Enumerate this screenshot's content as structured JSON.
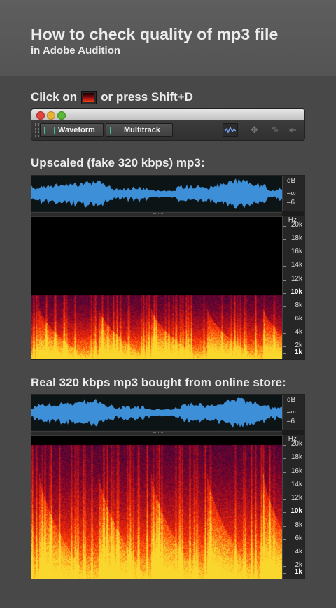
{
  "header": {
    "title": "How to check quality of mp3 file",
    "subtitle": "in Adobe Audition"
  },
  "instruction": {
    "prefix": "Click on",
    "suffix": "or press Shift+D"
  },
  "toolbar": {
    "waveform_label": "Waveform",
    "multitrack_label": "Multitrack"
  },
  "panels": [
    {
      "label": "Upscaled (fake 320 kbps) mp3:",
      "db_labels": [
        "dB",
        "–∞",
        "–6"
      ],
      "hz_labels": [
        "Hz",
        "20k",
        "18k",
        "16k",
        "14k",
        "12k",
        "10k",
        "8k",
        "6k",
        "4k",
        "2k",
        "1k"
      ],
      "cutoff_khz": 10
    },
    {
      "label": "Real 320 kbps mp3 bought from online store:",
      "db_labels": [
        "dB",
        "–∞",
        "–6"
      ],
      "hz_labels": [
        "Hz",
        "20k",
        "18k",
        "16k",
        "14k",
        "12k",
        "10k",
        "8k",
        "6k",
        "4k",
        "2k",
        "1k"
      ],
      "cutoff_khz": 20
    }
  ],
  "colors": {
    "background": "#484848",
    "header_bg": "#5a5a5a",
    "waveform": "#3d8fd8",
    "spectrum_hot": "#ffd040",
    "spectrum_mid": "#e03010",
    "spectrum_cold": "#2a0840"
  }
}
